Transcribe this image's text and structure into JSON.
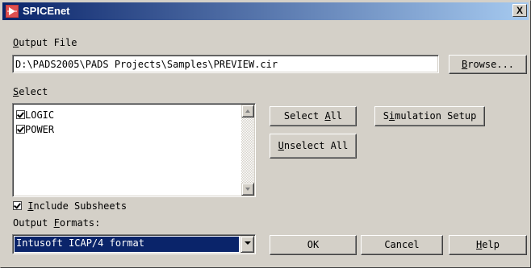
{
  "window": {
    "title": "SPICEnet",
    "close_glyph": "X"
  },
  "output_file": {
    "label_accel": "O",
    "label_rest": "utput File",
    "value": "D:\\PADS2005\\PADS Projects\\Samples\\PREVIEW.cir",
    "browse_accel": "B",
    "browse_rest": "rowse..."
  },
  "select": {
    "label_accel": "S",
    "label_rest": "elect",
    "items": [
      {
        "label": "LOGIC",
        "checked": true
      },
      {
        "label": "POWER",
        "checked": true
      }
    ],
    "select_all_pre": "Select ",
    "select_all_accel": "A",
    "select_all_post": "ll",
    "unselect_all_accel": "U",
    "unselect_all_rest": "nselect All",
    "simulation_setup_pre": "S",
    "simulation_setup_accel": "i",
    "simulation_setup_post": "mulation Setup"
  },
  "include_subsheets": {
    "checked": true,
    "accel": "I",
    "rest": "nclude Subsheets"
  },
  "output_formats": {
    "label_pre": "Output ",
    "label_accel": "F",
    "label_post": "ormats:",
    "selected": "Intusoft ICAP/4 format"
  },
  "buttons": {
    "ok": "OK",
    "cancel": "Cancel",
    "help_accel": "H",
    "help_rest": "elp"
  },
  "icons": {
    "app": "spicenet-app-icon",
    "close": "close-icon",
    "scroll_up": "scroll-up-arrow-icon",
    "scroll_down": "scroll-down-arrow-icon",
    "dropdown": "chevron-down-icon"
  },
  "colors": {
    "titlebar_start": "#0a246a",
    "titlebar_end": "#a6caf0",
    "face": "#d4d0c8",
    "selection": "#0a246a"
  }
}
